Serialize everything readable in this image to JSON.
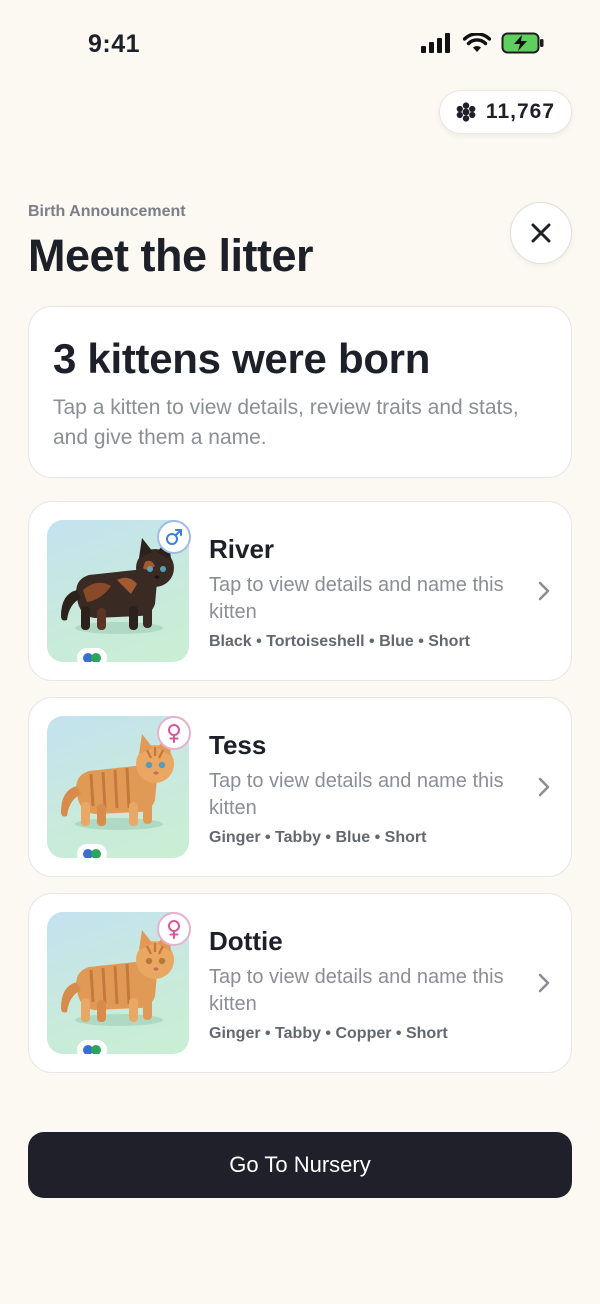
{
  "status_bar": {
    "time": "9:41"
  },
  "currency": {
    "value": "11,767",
    "icon": "paw-icon"
  },
  "header": {
    "eyebrow": "Birth Announcement",
    "title": "Meet the litter"
  },
  "summary": {
    "title": "3 kittens were born",
    "description": "Tap a kitten to view details, review traits and stats, and give them a name."
  },
  "kittens": [
    {
      "name": "River",
      "gender": "male",
      "description": "Tap to view details and name this kitten",
      "traits": "Black • Tortoiseshell • Blue • Short"
    },
    {
      "name": "Tess",
      "gender": "female",
      "description": "Tap to view details and name this kitten",
      "traits": "Ginger • Tabby • Blue • Short"
    },
    {
      "name": "Dottie",
      "gender": "female",
      "description": "Tap to view details and name this kitten",
      "traits": "Ginger • Tabby • Copper • Short"
    }
  ],
  "cta": {
    "label": "Go To Nursery"
  },
  "colors": {
    "background": "#fcf8f2",
    "male": "#3b7fd6",
    "female": "#d9559c",
    "button": "#1f2029"
  }
}
